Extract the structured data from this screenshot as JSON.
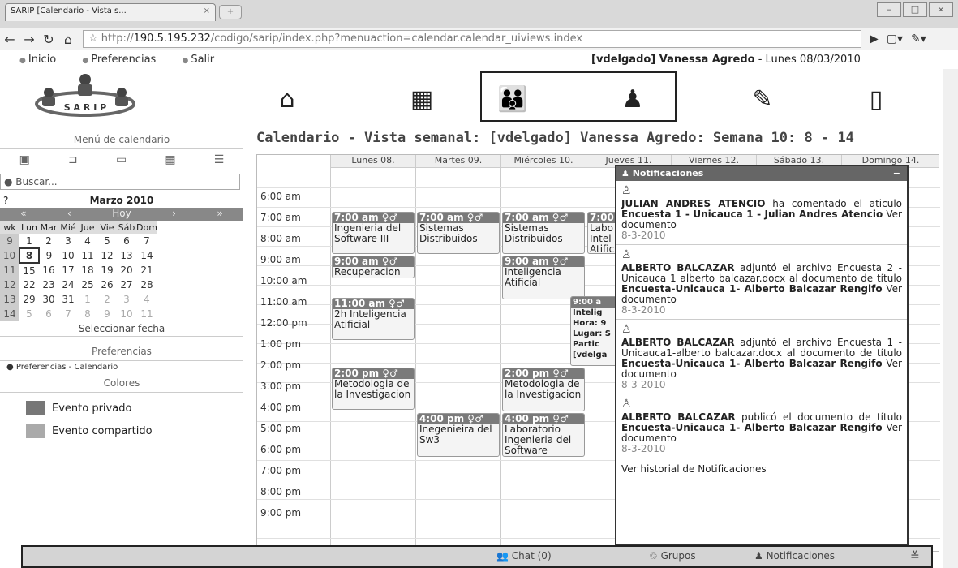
{
  "browser": {
    "tab_title": "SARIP [Calendario - Vista s...",
    "url_prefix": "http://",
    "url_host": "190.5.195.232",
    "url_path": "/codigo/sarip/index.php?menuaction=calendar.calendar_uiviews.index"
  },
  "topmenu": [
    "Inicio",
    "Preferencias",
    "Salir"
  ],
  "userinfo": {
    "user": "[vdelgado] Vanessa Agredo",
    "date": " - Lunes 08/03/2010"
  },
  "logo_text": "S A R I P",
  "app_icons": [
    "home-icon",
    "calendar-app-icon",
    "users-group-icon",
    "person-icon",
    "notes-icon",
    "door-exit-icon"
  ],
  "sidebar": {
    "title": "Menú de calendario",
    "search_placeholder": "Buscar...",
    "month": "Marzo 2010",
    "nav": [
      "«",
      "‹",
      "Hoy",
      "›",
      "»"
    ],
    "weekdays": [
      "wk",
      "Lun",
      "Mar",
      "Mié",
      "Jue",
      "Vie",
      "Sáb",
      "Dom"
    ],
    "weeks": [
      [
        "9",
        "1",
        "2",
        "3",
        "4",
        "5",
        "6",
        "7"
      ],
      [
        "10",
        "8",
        "9",
        "10",
        "11",
        "12",
        "13",
        "14"
      ],
      [
        "11",
        "15",
        "16",
        "17",
        "18",
        "19",
        "20",
        "21"
      ],
      [
        "12",
        "22",
        "23",
        "24",
        "25",
        "26",
        "27",
        "28"
      ],
      [
        "13",
        "29",
        "30",
        "31",
        "1",
        "2",
        "3",
        "4"
      ],
      [
        "14",
        "5",
        "6",
        "7",
        "8",
        "9",
        "10",
        "11"
      ]
    ],
    "select_date": "Seleccionar fecha",
    "pref_title": "Preferencias",
    "pref_item": "Preferencias - Calendario",
    "colors_title": "Colores",
    "legend": [
      {
        "label": "Evento privado",
        "color": "#777777"
      },
      {
        "label": "Evento compartido",
        "color": "#aaaaaa"
      }
    ]
  },
  "calendar": {
    "title": "Calendario - Vista semanal: [vdelgado] Vanessa Agredo: Semana 10: 8 - 14",
    "days": [
      "Lunes 08.",
      "Martes 09.",
      "Miércoles 10.",
      "Jueves 11.",
      "Viernes 12.",
      "Sábado 13.",
      "Domingo 14."
    ],
    "times": [
      "6:00 am",
      "7:00 am",
      "8:00 am",
      "9:00 am",
      "10:00 am",
      "11:00 am",
      "12:00 pm",
      "1:00 pm",
      "2:00 pm",
      "3:00 pm",
      "4:00 pm",
      "5:00 pm",
      "6:00 pm",
      "7:00 pm",
      "8:00 pm",
      "9:00 pm"
    ],
    "events": [
      {
        "head": "7:00 am ♀♂",
        "body": "Ingenieria del Software III"
      },
      {
        "head": "9:00 am ♀♂",
        "body": "Recuperacion"
      },
      {
        "head": "11:00 am ♀♂",
        "body": "2h Inteligencia Atificial"
      },
      {
        "head": "2:00 pm ♀♂",
        "body": "Metodologia de la Investigacion"
      },
      {
        "head": "7:00 am ♀♂",
        "body": "Sistemas Distribuidos"
      },
      {
        "head": "4:00 pm ♀♂",
        "body": "Inegenieira del Sw3"
      },
      {
        "head": "7:00 am ♀♂",
        "body": "Sistemas Distribuidos"
      },
      {
        "head": "9:00 am ♀♂",
        "body": "Inteligencia Atificial"
      },
      {
        "head": "2:00 pm ♀♂",
        "body": "Metodologia de la Investigacion"
      },
      {
        "head": "4:00 pm ♀♂",
        "body": "Laboratorio Ingenieria del Software"
      },
      {
        "head": "7:00",
        "body": "Labo Intel Atific"
      },
      {
        "head": "9:00 a",
        "body": "Intelig Hora: 9 Lugar: S Partic [vdelga"
      }
    ]
  },
  "notifications": {
    "title": "Notificaciones",
    "items": [
      {
        "who": "JULIAN ANDRES ATENCIO",
        "text1": " ha comentado el aticulo ",
        "doc": "Encuesta 1 - Unicauca 1 - Julian Andres Atencio",
        "link": " Ver documento",
        "date": "8-3-2010"
      },
      {
        "who": "ALBERTO BALCAZAR",
        "text1": " adjuntó el archivo Encuesta 2 - Unicauca 1 alberto balcazar.docx al documento de título ",
        "doc": "Encuesta-Unicauca 1- Alberto Balcazar Rengifo",
        "link": " Ver documento",
        "date": "8-3-2010"
      },
      {
        "who": "ALBERTO BALCAZAR",
        "text1": " adjuntó el archivo Encuesta 1 - Unicauca1-alberto balcazar.docx al documento de título ",
        "doc": "Encuesta-Unicauca 1- Alberto Balcazar Rengifo",
        "link": " Ver documento",
        "date": "8-3-2010"
      },
      {
        "who": "ALBERTO BALCAZAR",
        "text1": " publicó el documento de título ",
        "doc": "Encuesta-Unicauca 1- Alberto Balcazar Rengifo",
        "link": " Ver documento",
        "date": "8-3-2010"
      }
    ],
    "footer": "Ver historial de Notificaciones"
  },
  "bottombar": {
    "chat": "Chat (0)",
    "groups": "Grupos",
    "notifications": "Notificaciones"
  }
}
